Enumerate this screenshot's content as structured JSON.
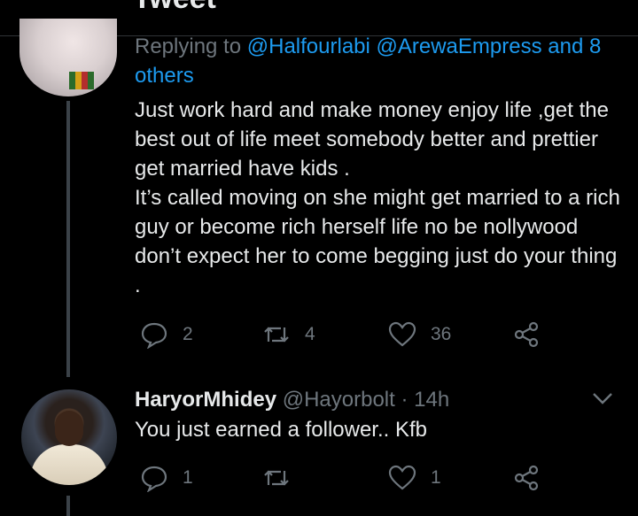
{
  "header": {
    "title": "Tweet"
  },
  "tweet1": {
    "replying_prefix": "Replying to ",
    "mentions": "@Halfourlabi @ArewaEmpress and 8 others",
    "paragraph1": "Just work hard and make money enjoy life ,get the best out of life meet somebody better and prettier get married have kids .",
    "paragraph2": "It’s called moving on she might get married to a rich guy or become rich herself life no be nollywood don’t expect her to come begging just do your thing .",
    "replies": "2",
    "retweets": "4",
    "likes": "36"
  },
  "tweet2": {
    "name": "HaryorMhidey",
    "handle": "@Hayorbolt",
    "separator": " · ",
    "time": "14h",
    "text": "You just earned a follower.. Kfb",
    "replies": "1",
    "retweets": "",
    "likes": "1"
  },
  "icons": {
    "reply": "speech-bubble-icon",
    "retweet": "retweet-arrows-icon",
    "like": "heart-icon",
    "share": "share-nodes-icon",
    "more": "chevron-down-icon"
  },
  "colors": {
    "background": "#000000",
    "link": "#1d9bf0",
    "muted": "#6e767d",
    "text": "#e7e9ea"
  }
}
